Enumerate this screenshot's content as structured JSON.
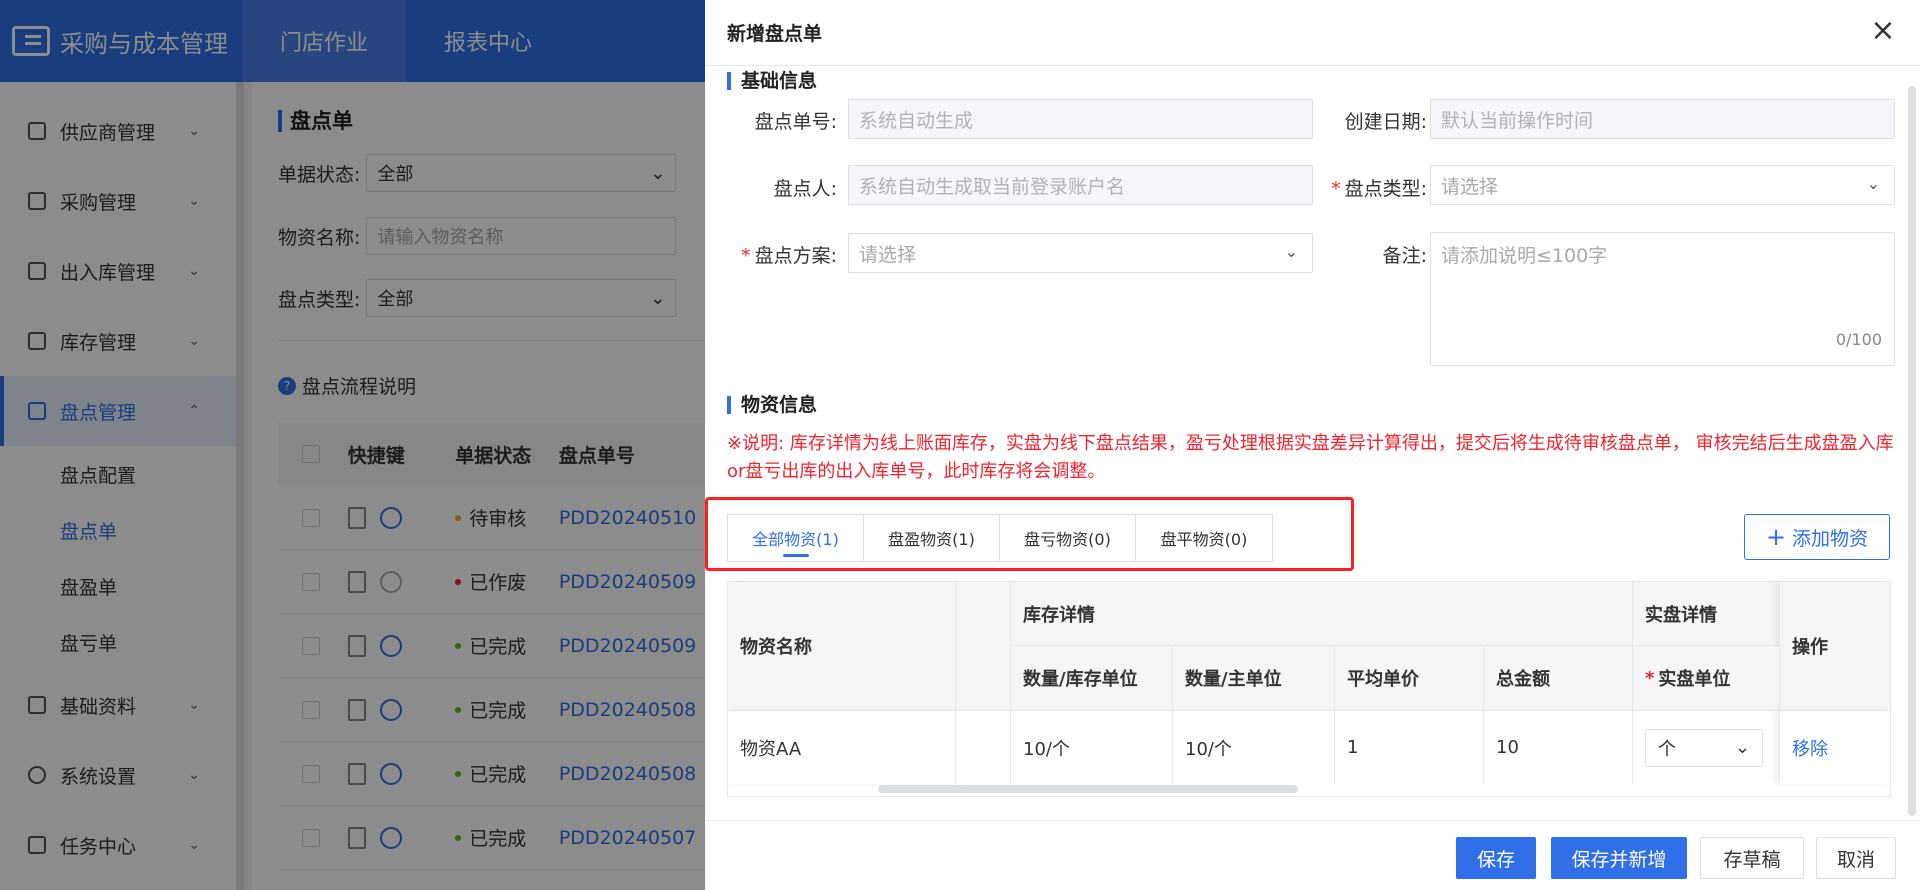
{
  "app": {
    "title": "采购与成本管理",
    "top_nav": [
      "门店作业",
      "报表中心"
    ]
  },
  "sidebar": {
    "items": [
      {
        "label": "供应商管理"
      },
      {
        "label": "采购管理"
      },
      {
        "label": "出入库管理"
      },
      {
        "label": "库存管理"
      },
      {
        "label": "盘点管理"
      },
      {
        "label": "基础资料"
      },
      {
        "label": "系统设置"
      },
      {
        "label": "任务中心"
      }
    ],
    "sub_items": [
      "盘点配置",
      "盘点单",
      "盘盈单",
      "盘亏单"
    ]
  },
  "page": {
    "title": "盘点单",
    "filters": {
      "status_label": "单据状态:",
      "status_value": "全部",
      "name_label": "物资名称:",
      "name_placeholder": "请输入物资名称",
      "type_label": "盘点类型:",
      "type_value": "全部"
    },
    "help": "盘点流程说明",
    "table": {
      "headers": [
        "快捷键",
        "单据状态",
        "盘点单号"
      ],
      "rows": [
        {
          "status": "待审核",
          "status_color": "#f5a623",
          "no": "PDD20240510"
        },
        {
          "status": "已作废",
          "status_color": "#f5222d",
          "no": "PDD20240509"
        },
        {
          "status": "已完成",
          "status_color": "#52c41a",
          "no": "PDD20240509"
        },
        {
          "status": "已完成",
          "status_color": "#52c41a",
          "no": "PDD20240508"
        },
        {
          "status": "已完成",
          "status_color": "#52c41a",
          "no": "PDD20240508"
        },
        {
          "status": "已完成",
          "status_color": "#52c41a",
          "no": "PDD20240507"
        }
      ]
    }
  },
  "drawer": {
    "title": "新增盘点单",
    "basic_section": "基础信息",
    "fields": {
      "no_label": "盘点单号:",
      "no_placeholder": "系统自动生成",
      "date_label": "创建日期:",
      "date_placeholder": "默认当前操作时间",
      "person_label": "盘点人:",
      "person_placeholder": "系统自动生成取当前登录账户名",
      "type_label": "盘点类型:",
      "type_placeholder": "请选择",
      "plan_label": "盘点方案:",
      "plan_placeholder": "请选择",
      "remark_label": "备注:",
      "remark_placeholder": "请添加说明≤100字",
      "remark_count": "0/100"
    },
    "item_section": "物资信息",
    "note": "※说明: 库存详情为线上账面库存，实盘为线下盘点结果，盈亏处理根据实盘差异计算得出，提交后将生成待审核盘点单， 审核完结后生成盘盈入库or盘亏出库的出入库单号，此时库存将会调整。",
    "tabs": [
      "全部物资(1)",
      "盘盈物资(1)",
      "盘亏物资(0)",
      "盘平物资(0)"
    ],
    "add_button": "添加物资",
    "table": {
      "col_name": "物资名称",
      "group_stock": "库存详情",
      "group_actual": "实盘详情",
      "col_op": "操作",
      "sub_headers": [
        "数量/库存单位",
        "数量/主单位",
        "平均单价",
        "总金额",
        "实盘单位"
      ],
      "rows": [
        {
          "name": "物资AA",
          "qty_stock": "10/个",
          "qty_main": "10/个",
          "avg_price": "1",
          "total": "10",
          "unit": "个",
          "op": "移除"
        }
      ]
    },
    "buttons": {
      "save": "保存",
      "save_new": "保存并新增",
      "draft": "存草稿",
      "cancel": "取消"
    }
  }
}
